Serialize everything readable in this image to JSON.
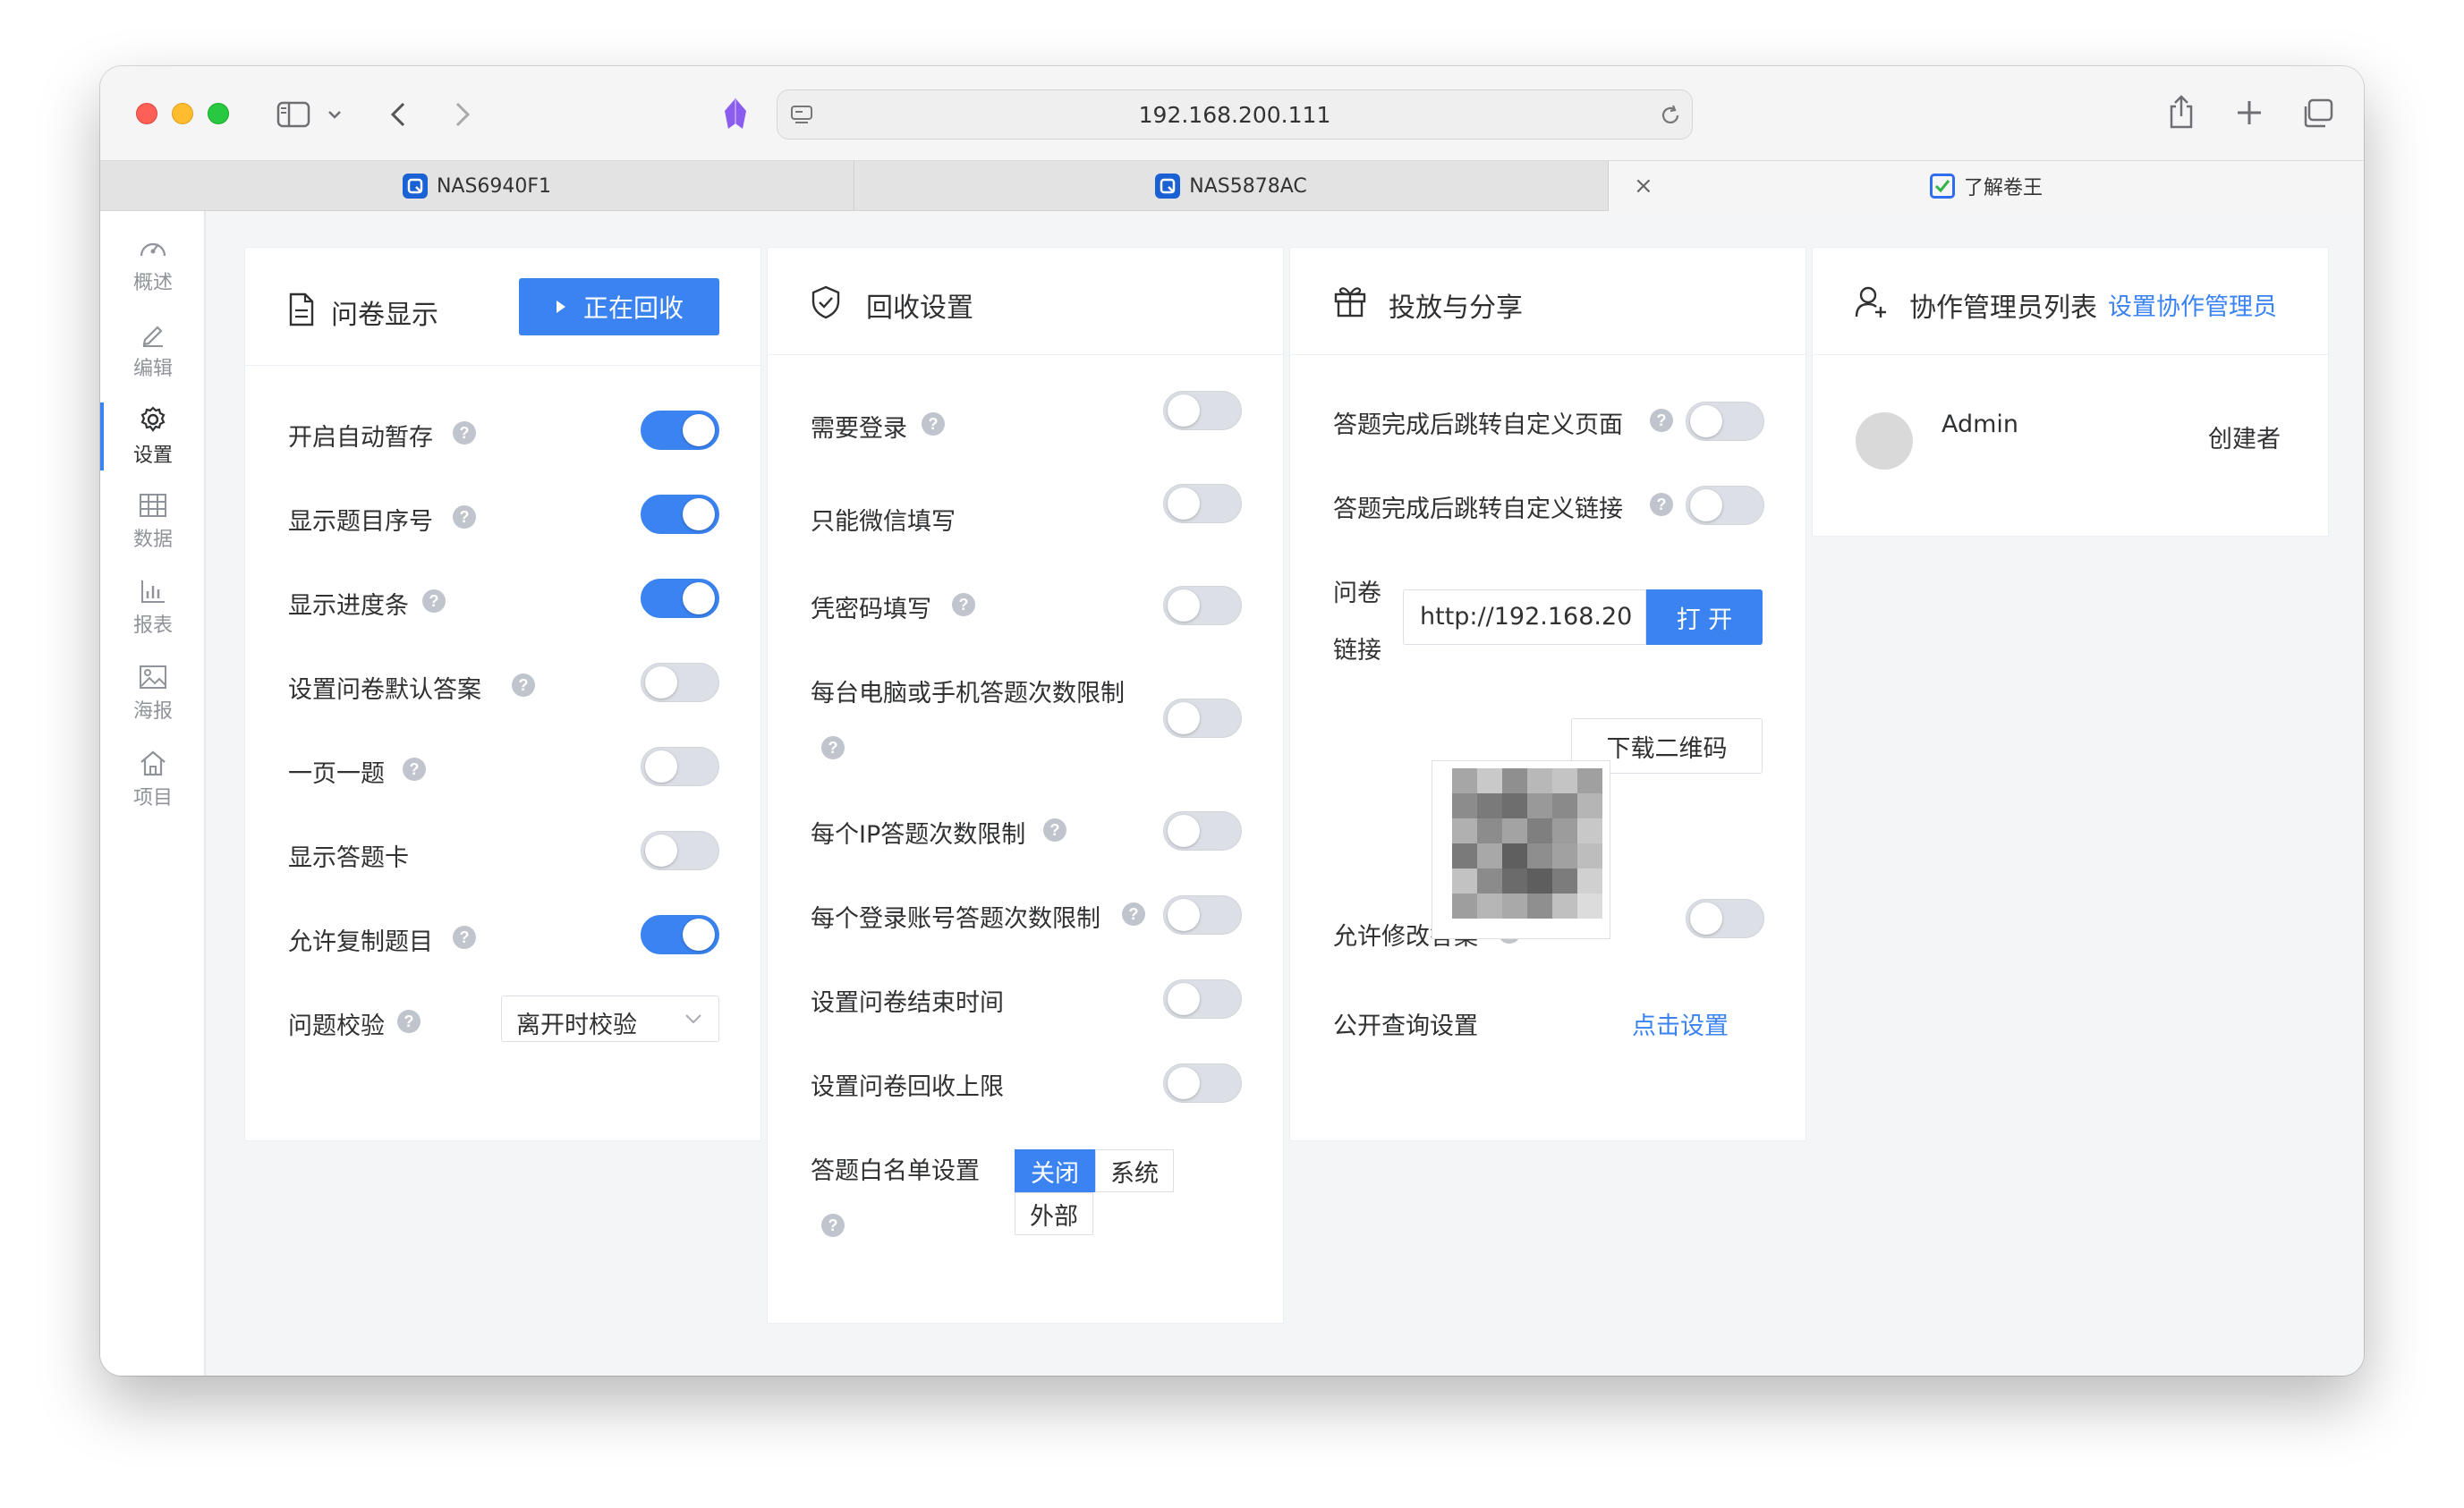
{
  "browser": {
    "url": "192.168.200.111",
    "tabs": [
      {
        "label": "NAS6940F1"
      },
      {
        "label": "NAS5878AC"
      },
      {
        "label": "了解卷王"
      }
    ]
  },
  "sidebar": {
    "items": [
      {
        "label": "概述",
        "icon": "dashboard-icon"
      },
      {
        "label": "编辑",
        "icon": "edit-icon"
      },
      {
        "label": "设置",
        "icon": "gear-icon",
        "active": true
      },
      {
        "label": "数据",
        "icon": "table-icon"
      },
      {
        "label": "报表",
        "icon": "bar-chart-icon"
      },
      {
        "label": "海报",
        "icon": "image-icon"
      },
      {
        "label": "项目",
        "icon": "home-icon"
      }
    ]
  },
  "display_card": {
    "title": "问卷显示",
    "status_button": "正在回收",
    "rows": [
      {
        "label": "开启自动暂存",
        "on": true
      },
      {
        "label": "显示题目序号",
        "on": true
      },
      {
        "label": "显示进度条",
        "on": true
      },
      {
        "label": "设置问卷默认答案",
        "on": false
      },
      {
        "label": "一页一题",
        "on": false
      },
      {
        "label": "显示答题卡",
        "on": false
      },
      {
        "label": "允许复制题目",
        "on": true
      }
    ],
    "validation": {
      "label": "问题校验",
      "value": "离开时校验"
    }
  },
  "collect_card": {
    "title": "回收设置",
    "rows": [
      {
        "label": "需要登录",
        "on": false
      },
      {
        "label": "只能微信填写",
        "on": false
      },
      {
        "label": "凭密码填写",
        "on": false
      },
      {
        "label": "每台电脑或手机答题次数限制",
        "on": false
      },
      {
        "label": "每个IP答题次数限制",
        "on": false
      },
      {
        "label": "每个登录账号答题次数限制",
        "on": false
      },
      {
        "label": "设置问卷结束时间",
        "on": false
      },
      {
        "label": "设置问卷回收上限",
        "on": false
      }
    ],
    "whitelist": {
      "label": "答题白名单设置",
      "options": [
        "关闭",
        "系统",
        "外部"
      ],
      "selected": "关闭"
    }
  },
  "share_card": {
    "title": "投放与分享",
    "rows": [
      {
        "label": "答题完成后跳转自定义页面",
        "on": false
      },
      {
        "label": "答题完成后跳转自定义链接",
        "on": false
      }
    ],
    "link_label_line1": "问卷",
    "link_label_line2": "链接",
    "link_value": "http://192.168.20",
    "open_button": "打 开",
    "download_qr_button": "下载二维码",
    "allow_modify": {
      "label": "允许修改答案",
      "on": false
    },
    "public_query": {
      "label": "公开查询设置",
      "action": "点击设置"
    }
  },
  "admin_card": {
    "title": "协作管理员列表",
    "set_link": "设置协作管理员",
    "admins": [
      {
        "name": "Admin",
        "role": "创建者"
      }
    ]
  },
  "colors": {
    "accent": "#3a83f1",
    "switch_off": "#dcdfe6",
    "help_icon": "#c0c4cc"
  }
}
